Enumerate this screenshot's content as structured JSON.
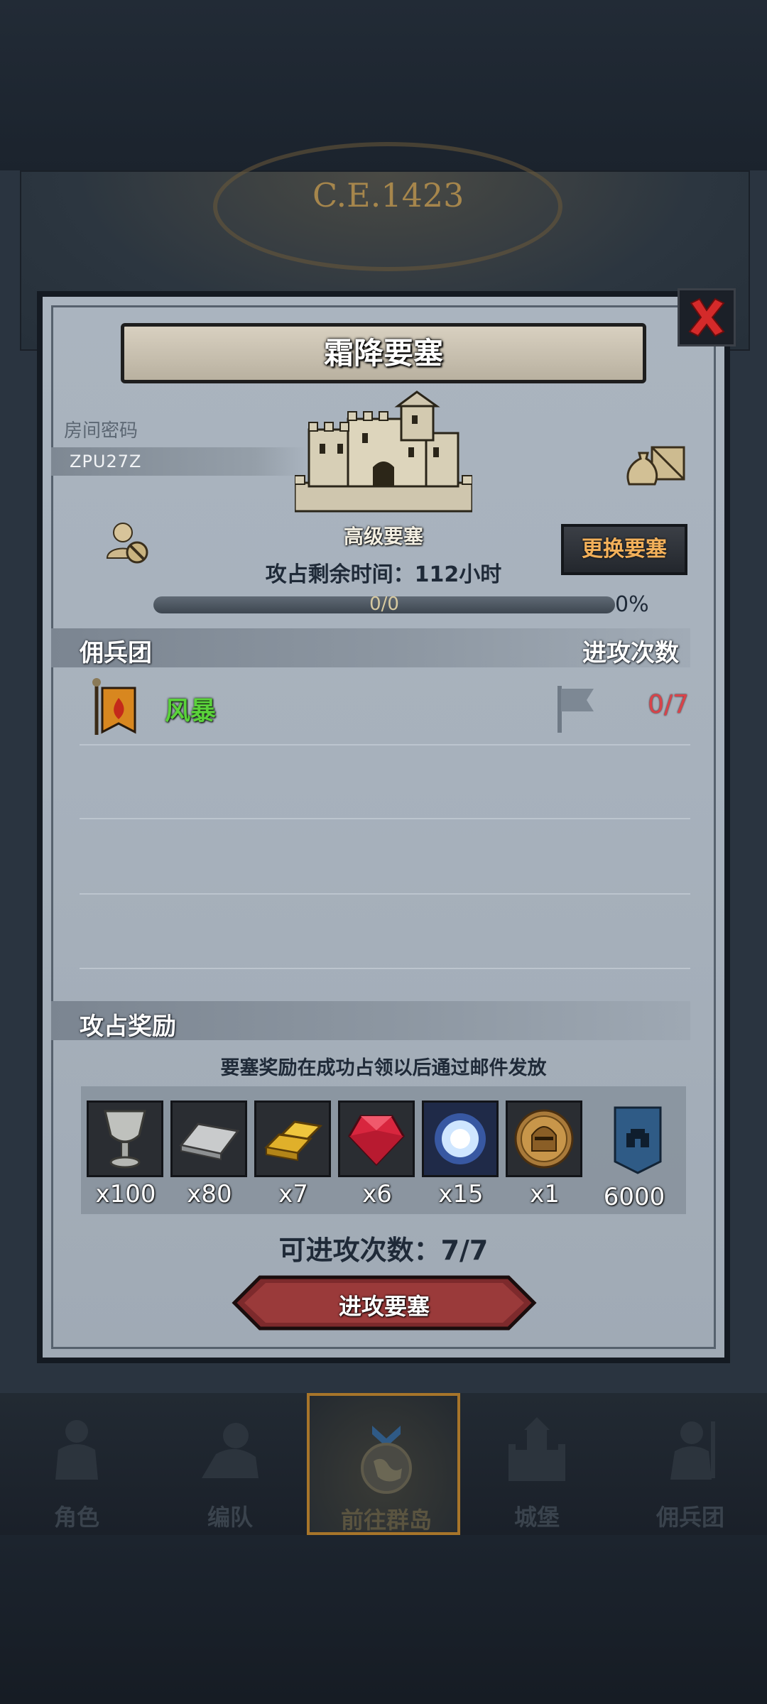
{
  "header": {
    "year": "C.E.1423"
  },
  "dialog": {
    "title": "霜降要塞",
    "room": {
      "label": "房间密码",
      "code": "ZPU27Z"
    },
    "fortress_name": "高级要塞",
    "change_button": "更换要塞",
    "time_left": "攻占剩余时间：112小时",
    "progress": {
      "text": "0/0",
      "percent_label": "0%",
      "fraction": 0
    },
    "mercenary_section": {
      "title": "佣兵团",
      "count_header": "进攻次数"
    },
    "mercenaries": [
      {
        "name": "风暴",
        "attacks": "0/7"
      }
    ],
    "rewards": {
      "title": "攻占奖励",
      "note": "要塞奖励在成功占领以后通过邮件发放",
      "items": [
        {
          "icon": "chalice-icon",
          "qty": "x100"
        },
        {
          "icon": "iron-ingot-icon",
          "qty": "x80"
        },
        {
          "icon": "gold-bars-icon",
          "qty": "x7"
        },
        {
          "icon": "ruby-gem-icon",
          "qty": "x6"
        },
        {
          "icon": "blue-crystal-icon",
          "qty": "x15"
        },
        {
          "icon": "knight-medal-icon",
          "qty": "x1"
        },
        {
          "icon": "fortress-banner-icon",
          "qty": "6000"
        }
      ]
    },
    "attack_available": "可进攻次数：7/7",
    "attack_button": "进攻要塞"
  },
  "nav": {
    "items": [
      {
        "label": "角色",
        "icon": "knight-armor-icon"
      },
      {
        "label": "编队",
        "icon": "formation-icon"
      },
      {
        "label": "前往群岛",
        "icon": "globe-icon",
        "active": true
      },
      {
        "label": "城堡",
        "icon": "castle-icon"
      },
      {
        "label": "佣兵团",
        "icon": "mercenary-icon"
      }
    ]
  },
  "colors": {
    "accent_gold": "#c9a04b",
    "mercenary_green": "#5ad23a",
    "count_red": "#d9434a",
    "panel_bg": "#a7b1bc"
  }
}
